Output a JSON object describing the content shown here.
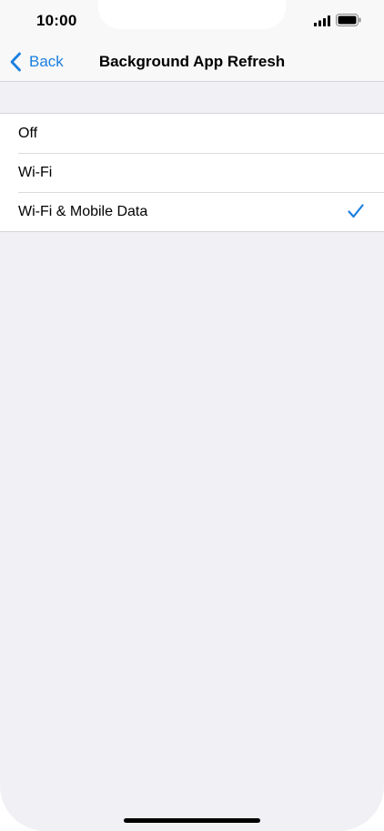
{
  "status_bar": {
    "time": "10:00",
    "signal_icon": "signal-bars-icon",
    "battery_icon": "battery-full-icon"
  },
  "nav": {
    "back_label": "Back",
    "back_icon": "chevron-left-icon",
    "title": "Background App Refresh"
  },
  "options": [
    {
      "label": "Off",
      "selected": false
    },
    {
      "label": "Wi-Fi",
      "selected": false
    },
    {
      "label": "Wi-Fi & Mobile Data",
      "selected": true
    }
  ],
  "colors": {
    "accent": "#1a7fe0",
    "background": "#f0f0f5",
    "header": "#f8f8f8"
  }
}
